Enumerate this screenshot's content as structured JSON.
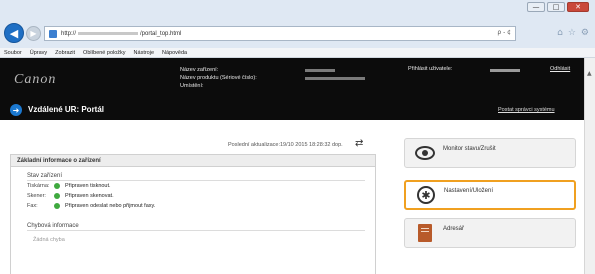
{
  "browser": {
    "url_prefix": "http://",
    "url_path": "/portal_top.html",
    "addr_tools": "ρ - ¢",
    "controls": {
      "minimize": "—",
      "maximize": "□",
      "close": "✕"
    },
    "icons": [
      "home-icon",
      "star-icon",
      "gear-icon"
    ]
  },
  "menu": [
    "Soubor",
    "Úpravy",
    "Zobrazit",
    "Oblíbené položky",
    "Nástroje",
    "Nápověda"
  ],
  "header": {
    "device_name_label": "Název zařízení:",
    "product_name_label": "Název produktu (Sériové číslo):",
    "location_label": "Umístění:",
    "login_label": "Přihlásit uživatele:",
    "logout": "Odhlásit",
    "portal_title": "Vzdálené UR: Portál",
    "admin_link": "Postat správci systému"
  },
  "content": {
    "last_update": "Poslední aktualizace:19/10 2015 18:28:32 dop.",
    "panel_title": "Základní informace o zařízení",
    "status_title": "Stav zařízení",
    "status_rows": [
      {
        "label": "Tiskárna:",
        "value": "Připraven tisknout."
      },
      {
        "label": "Skener:",
        "value": "Připraven skenovat."
      },
      {
        "label": "Fax:",
        "value": "Připraven odeslat nebo přijmout faxy."
      }
    ],
    "error_title": "Chybová informace",
    "error_value": "Žádná chyba"
  },
  "side": {
    "monitor": "Monitor stavu/Zrušit",
    "settings": "Nastavení/Uložení",
    "address": "Adresář"
  },
  "colors": {
    "accent_selected": "#f0a020",
    "status_ok": "#3fa93f",
    "header_bg": "#0c0c0c"
  }
}
